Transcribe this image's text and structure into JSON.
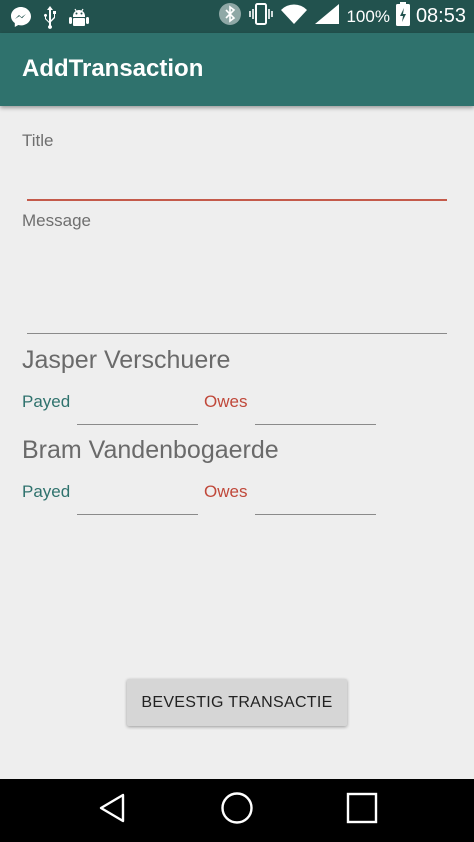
{
  "status_bar": {
    "icons_left": [
      "messenger-icon",
      "usb-icon",
      "android-debug-icon"
    ],
    "icons_right": [
      "bluetooth-icon",
      "vibrate-icon",
      "wifi-icon",
      "signal-icon",
      "battery-charging-icon"
    ],
    "battery": "100%",
    "time": "08:53"
  },
  "app_bar": {
    "title": "AddTransaction"
  },
  "form": {
    "title_label": "Title",
    "title_value": "",
    "message_label": "Message",
    "message_value": ""
  },
  "people": [
    {
      "name": "Jasper Verschuere",
      "payed_label": "Payed",
      "payed_value": "",
      "owes_label": "Owes",
      "owes_value": ""
    },
    {
      "name": "Bram Vandenbogaerde",
      "payed_label": "Payed",
      "payed_value": "",
      "owes_label": "Owes",
      "owes_value": ""
    }
  ],
  "confirm_button": "BEVESTIG TRANSACTIE",
  "nav_bar": {
    "icons": [
      "back-icon",
      "home-icon",
      "recents-icon"
    ]
  },
  "colors": {
    "primary": "#2f726d",
    "primary_dark": "#22524e",
    "accent": "#c45a4a",
    "background": "#eeeeee"
  }
}
